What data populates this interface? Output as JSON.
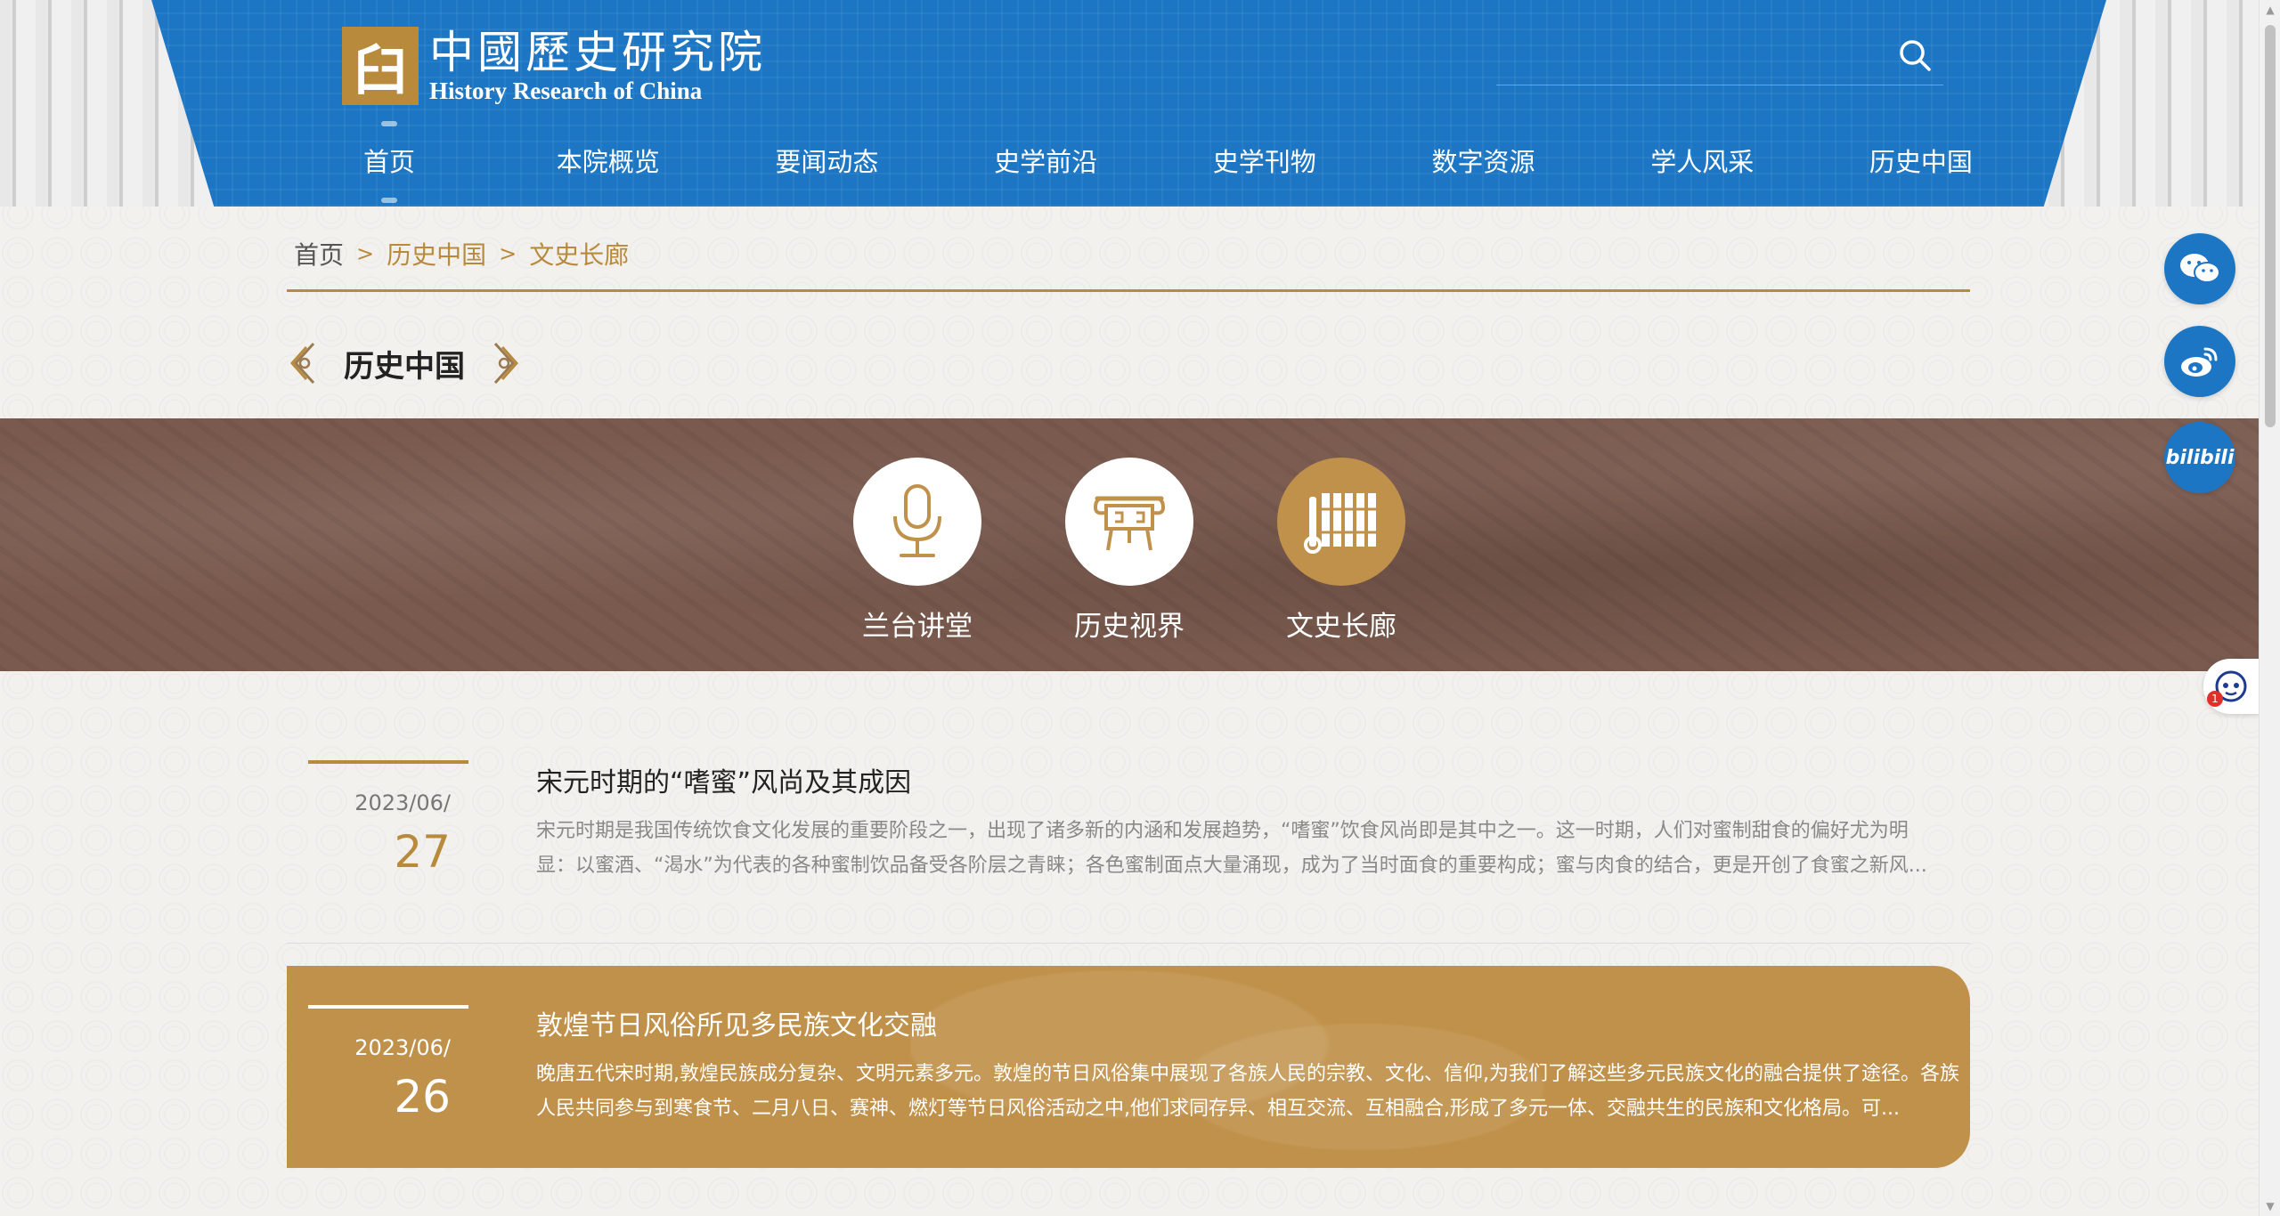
{
  "header": {
    "logo_mark": "⾅",
    "logo_cn": "中國歷史研究院",
    "logo_en": "History Research of China",
    "search_placeholder": ""
  },
  "nav": {
    "items": [
      {
        "label": "首页",
        "active": true
      },
      {
        "label": "本院概览"
      },
      {
        "label": "要闻动态"
      },
      {
        "label": "史学前沿"
      },
      {
        "label": "史学刊物"
      },
      {
        "label": "数字资源"
      },
      {
        "label": "学人风采"
      },
      {
        "label": "历史中国"
      }
    ]
  },
  "breadcrumb": {
    "home": "首页",
    "sep": ">",
    "level1": "历史中国",
    "level2": "文史长廊"
  },
  "section": {
    "title": "历史中国"
  },
  "categories": [
    {
      "label": "兰台讲堂",
      "icon": "microphone-icon"
    },
    {
      "label": "历史视界",
      "icon": "ding-vessel-icon"
    },
    {
      "label": "文史长廊",
      "icon": "bamboo-scroll-icon",
      "active": true
    }
  ],
  "articles": [
    {
      "date_ym": "2023/06/",
      "date_d": "27",
      "title": "宋元时期的“嗜蜜”风尚及其成因",
      "summary": "宋元时期是我国传统饮食文化发展的重要阶段之一，出现了诸多新的内涵和发展趋势，“嗜蜜”饮食风尚即是其中之一。这一时期，人们对蜜制甜食的偏好尤为明显：以蜜酒、“渴水”为代表的各种蜜制饮品备受各阶层之青睐；各色蜜制面点大量涌现，成为了当时面食的重要构成；蜜与肉食的结合，更是开创了食蜜之新风..."
    },
    {
      "date_ym": "2023/06/",
      "date_d": "26",
      "title": "敦煌节日风俗所见多民族文化交融",
      "summary": "晚唐五代宋时期,敦煌民族成分复杂、文明元素多元。敦煌的节日风俗集中展现了各族人民的宗教、文化、信仰,为我们了解这些多元民族文化的融合提供了途径。各族人民共同参与到寒食节、二月八日、赛神、燃灯等节日风俗活动之中,他们求同存异、相互交流、互相融合,形成了多元一体、交融共生的民族和文化格局。可..."
    }
  ],
  "floating": {
    "bili_label": "bilibili",
    "assistant_badge": "1"
  },
  "colors": {
    "brand_blue": "#1d76c4",
    "accent_gold": "#b88a3b",
    "band_brown": "#7a5a4e",
    "highlight_gold": "#c0914a"
  }
}
